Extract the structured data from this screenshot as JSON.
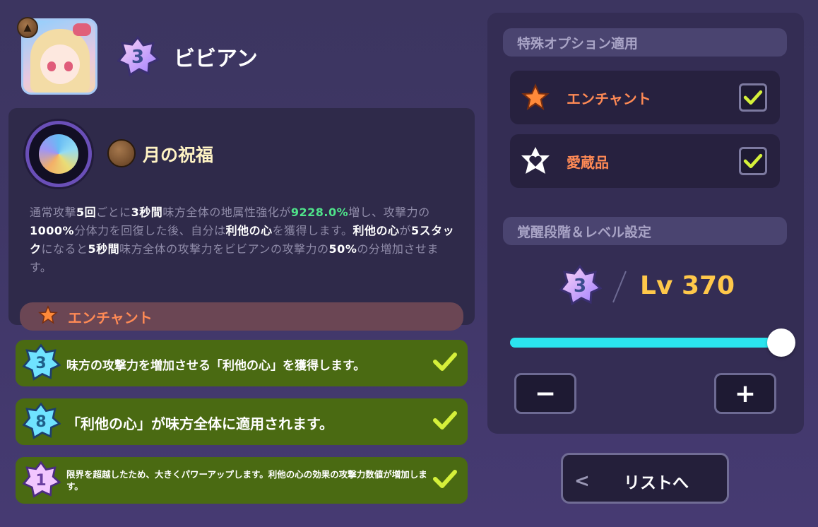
{
  "character": {
    "name": "ビビアン",
    "awakening": "3"
  },
  "skill": {
    "name": "月の祝福",
    "description_parts": [
      {
        "t": "通常攻撃",
        "s": "n"
      },
      {
        "t": "5回",
        "s": "b"
      },
      {
        "t": "ごとに",
        "s": "n"
      },
      {
        "t": "3秒間",
        "s": "b"
      },
      {
        "t": "味方全体の地属性強化が",
        "s": "n"
      },
      {
        "t": "9228.0%",
        "s": "g"
      },
      {
        "t": "増し、攻撃力の",
        "s": "n"
      },
      {
        "t": "1000%",
        "s": "b"
      },
      {
        "t": "分体力を回復した後、自分は",
        "s": "n"
      },
      {
        "t": "利他の心",
        "s": "b"
      },
      {
        "t": "を獲得します。",
        "s": "n"
      },
      {
        "t": "利他の心",
        "s": "b"
      },
      {
        "t": "が",
        "s": "n"
      },
      {
        "t": "5スタック",
        "s": "b"
      },
      {
        "t": "になると",
        "s": "n"
      },
      {
        "t": "5秒間",
        "s": "b"
      },
      {
        "t": "味方全体の攻撃力をビビアンの攻撃力の",
        "s": "n"
      },
      {
        "t": "50%",
        "s": "b"
      },
      {
        "t": "の分増加させます。",
        "s": "n"
      }
    ],
    "enchant_header": "エンチャント"
  },
  "unlocks": [
    {
      "badge": "3",
      "text": "味方の攻撃力を増加させる「利他の心」を獲得します。",
      "checked": true
    },
    {
      "badge": "8",
      "text": "「利他の心」が味方全体に適用されます。",
      "checked": true
    },
    {
      "badge": "1",
      "text": "限界を超越したため、大きくパワーアップします。利他の心の効果の攻撃力数値が増加します。",
      "checked": true
    }
  ],
  "options": {
    "header": "特殊オプション適用",
    "items": [
      {
        "label": "エンチャント",
        "icon": "star-icon",
        "checked": true
      },
      {
        "label": "愛蔵品",
        "icon": "heart-emblem-icon",
        "checked": true
      }
    ]
  },
  "level_settings": {
    "header": "覚醒段階＆レベル設定",
    "awakening": "3",
    "level_text": "Lv 370",
    "slider_fraction": 1.0,
    "minus_label": "−",
    "plus_label": "+"
  },
  "back_button": {
    "chevron": "<",
    "label": "リストへ"
  },
  "colors": {
    "background": "#3f3766",
    "accent_green_row": "#4a6a12",
    "check": "#d5f03a",
    "option_label": "#ff8a55",
    "level": "#ffc84a",
    "slider": "#2be4ef"
  }
}
